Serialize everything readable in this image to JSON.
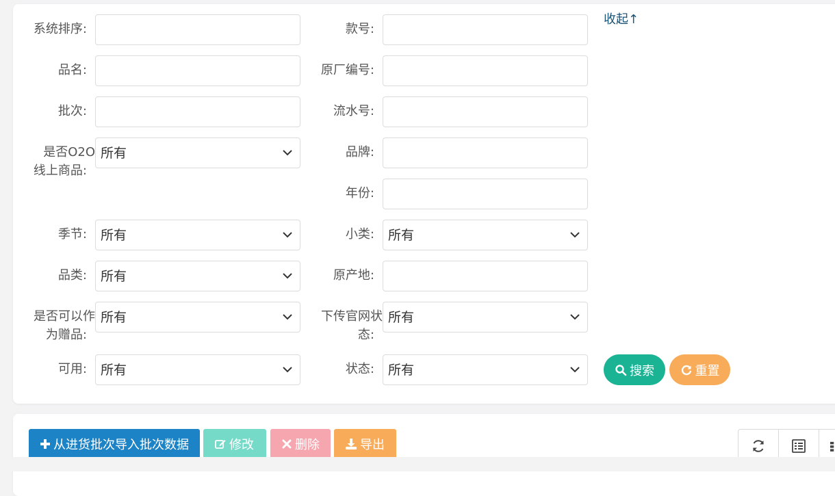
{
  "filters": {
    "col1": [
      {
        "label": "系统排序:",
        "type": "input",
        "value": ""
      },
      {
        "label": "品名:",
        "type": "input",
        "value": ""
      },
      {
        "label": "批次:",
        "type": "input",
        "value": ""
      },
      {
        "label_line1": "是否O2O",
        "label_line2": "线上商品:",
        "type": "select",
        "value": "所有"
      },
      {
        "label": "季节:",
        "type": "select",
        "value": "所有"
      },
      {
        "label": "品类:",
        "type": "select",
        "value": "所有"
      },
      {
        "label_line1": "是否可以作",
        "label_line2": "为赠品:",
        "type": "select",
        "value": "所有"
      },
      {
        "label": "可用:",
        "type": "select",
        "value": "所有"
      }
    ],
    "col2": [
      {
        "label": "款号:",
        "type": "input",
        "value": ""
      },
      {
        "label": "原厂编号:",
        "type": "input",
        "value": ""
      },
      {
        "label": "流水号:",
        "type": "input",
        "value": ""
      },
      {
        "label": "品牌:",
        "type": "input",
        "value": ""
      },
      {
        "label": "年份:",
        "type": "input",
        "value": ""
      },
      {
        "label": "小类:",
        "type": "select",
        "value": "所有"
      },
      {
        "label": "原产地:",
        "type": "input",
        "value": ""
      },
      {
        "label_line1": "下传官网状",
        "label_line2": "态:",
        "type": "select",
        "value": "所有"
      },
      {
        "label": "状态:",
        "type": "select",
        "value": "所有"
      }
    ]
  },
  "collapse_label": "收起↑",
  "search_button": {
    "label": "搜索",
    "color": "#1ab394"
  },
  "reset_button": {
    "label": "重置",
    "color": "#f8ac59"
  },
  "toolbar": {
    "import_label": "从进货批次导入批次数据",
    "edit_label": "修改",
    "delete_label": "删除",
    "export_label": "导出"
  },
  "colors": {
    "import": "#1c84c6",
    "edit": "#76dac9",
    "delete": "#f5a6ae",
    "export": "#f8ac59",
    "link": "#1a5276"
  },
  "icons": {
    "search": "search-icon",
    "reset": "refresh-icon",
    "import": "plus-icon",
    "edit": "edit-icon",
    "delete": "times-icon",
    "export": "download-icon",
    "refresh": "refresh-icon",
    "columns": "list-icon",
    "more": "grid-icon"
  }
}
